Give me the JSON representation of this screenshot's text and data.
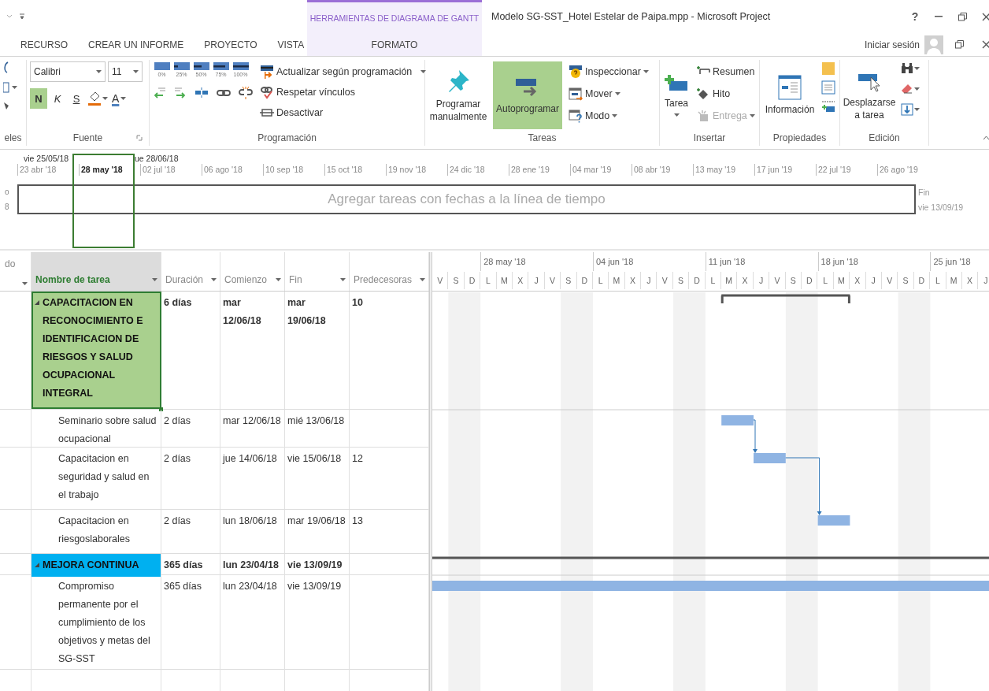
{
  "title_bar": {
    "contextual_group": "HERRAMIENTAS DE DIAGRAMA DE GANTT",
    "title": "Modelo SG-SST_Hotel Estelar de Paipa.mpp - Microsoft Project",
    "help": "?"
  },
  "tabs": [
    {
      "label": "RECURSO",
      "kind": "normal"
    },
    {
      "label": "CREAR UN INFORME",
      "kind": "normal"
    },
    {
      "label": "PROYECTO",
      "kind": "normal"
    },
    {
      "label": "VISTA",
      "kind": "normal"
    },
    {
      "label": "FORMATO",
      "kind": "contextual"
    }
  ],
  "account": {
    "label": "Iniciar sesión"
  },
  "ribbon": {
    "clipboard_group": {
      "label": "eles"
    },
    "font_group": {
      "label": "Fuente",
      "font": "Calibri",
      "size": "11",
      "font_color_letter": "A",
      "styles": [
        {
          "label": "N",
          "kind": "bold",
          "on": true
        },
        {
          "label": "K",
          "kind": "italic",
          "on": false
        },
        {
          "label": "S",
          "kind": "underline",
          "on": false
        }
      ]
    },
    "schedule_group": {
      "label": "Programación",
      "percent_buttons": [
        "0%",
        "25%",
        "50%",
        "75%",
        "100%"
      ],
      "commands": [
        {
          "label": "Actualizar según programación",
          "kind": "update",
          "menu": true
        },
        {
          "label": "Respetar vínculos",
          "kind": "respect",
          "menu": false
        },
        {
          "label": "Desactivar",
          "kind": "deactivate",
          "menu": false
        }
      ]
    },
    "tasks_group": {
      "label": "Tareas",
      "mode_buttons": [
        {
          "label": "Programar manualmente",
          "kind": "manual",
          "selected": false
        },
        {
          "label": "Autoprogramar",
          "kind": "auto",
          "selected": true
        }
      ],
      "commands": [
        {
          "label": "Inspeccionar",
          "kind": "inspect",
          "menu": true
        },
        {
          "label": "Mover",
          "kind": "move",
          "menu": true
        },
        {
          "label": "Modo",
          "kind": "mode",
          "menu": true
        }
      ]
    },
    "insert_group": {
      "label": "Insertar",
      "task_button": "Tarea",
      "commands": [
        {
          "label": "Resumen",
          "kind": "summary",
          "disabled": false,
          "menu": false
        },
        {
          "label": "Hito",
          "kind": "milestone",
          "disabled": false,
          "menu": false
        },
        {
          "label": "Entrega",
          "kind": "deliverable",
          "disabled": true,
          "menu": true
        }
      ]
    },
    "properties_group": {
      "label": "Propiedades",
      "info_button": "Información"
    },
    "editing_group": {
      "label": "Edición",
      "scroll_button": "Desplazarse a tarea"
    }
  },
  "timeline": {
    "range_start": "vie 25/05/18",
    "range_end": "ue 28/06/18",
    "start_fragments": [
      "o",
      "8"
    ],
    "ticks": [
      {
        "label": "23 abr '18",
        "highlighted": false
      },
      {
        "label": "28 may '18",
        "highlighted": true
      },
      {
        "label": "02 jul '18",
        "highlighted": false
      },
      {
        "label": "06 ago '18",
        "highlighted": false
      },
      {
        "label": "10 sep '18",
        "highlighted": false
      },
      {
        "label": "15 oct '18",
        "highlighted": false
      },
      {
        "label": "19 nov '18",
        "highlighted": false
      },
      {
        "label": "24 dic '18",
        "highlighted": false
      },
      {
        "label": "28 ene '19",
        "highlighted": false
      },
      {
        "label": "04 mar '19",
        "highlighted": false
      },
      {
        "label": "08 abr '19",
        "highlighted": false
      },
      {
        "label": "13 may '19",
        "highlighted": false
      },
      {
        "label": "17 jun '19",
        "highlighted": false
      },
      {
        "label": "22 jul '19",
        "highlighted": false
      },
      {
        "label": "26 ago '19",
        "highlighted": false
      }
    ],
    "placeholder": "Agregar tareas con fechas a la línea de tiempo",
    "finish_label": "Fin",
    "finish_date": "vie 13/09/19"
  },
  "table": {
    "columns": [
      {
        "label": "do",
        "kind": "cut",
        "selected": false
      },
      {
        "label": "Nombre de tarea",
        "kind": "normal",
        "selected": true
      },
      {
        "label": "Duración",
        "kind": "normal",
        "selected": false
      },
      {
        "label": "Comienzo",
        "kind": "normal",
        "selected": false
      },
      {
        "label": "Fin",
        "kind": "normal",
        "selected": false
      },
      {
        "label": "Predecesoras",
        "kind": "normal",
        "selected": false
      }
    ],
    "rows": [
      {
        "name": "CAPACITACION EN RECONOCIMIENTO E IDENTIFICACION DE RIESGOS Y SALUD OCUPACIONAL INTEGRAL",
        "kind": "summary",
        "expanded": true,
        "selected": true,
        "color": "#a9d08e",
        "duration": "6 días",
        "start": "mar 12/06/18",
        "finish": "mar 19/06/18",
        "predecessors": "10"
      },
      {
        "name": "Seminario sobre salud ocupacional",
        "kind": "task",
        "selected": false,
        "duration": "2 días",
        "start": "mar 12/06/18",
        "finish": "mié 13/06/18"
      },
      {
        "name": "Capacitacion en seguridad y salud en el trabajo",
        "kind": "task",
        "selected": false,
        "duration": "2 días",
        "start": "jue 14/06/18",
        "finish": "vie 15/06/18",
        "predecessors": "12"
      },
      {
        "name": "Capacitacion en riesgoslaborales",
        "kind": "task",
        "selected": false,
        "duration": "2 días",
        "start": "lun 18/06/18",
        "finish": "mar 19/06/18",
        "predecessors": "13"
      },
      {
        "name": "MEJORA CONTINUA",
        "kind": "summary",
        "expanded": true,
        "selected": false,
        "color": "#00b0f0",
        "duration": "365 días",
        "start": "lun 23/04/18",
        "finish": "vie 13/09/19"
      },
      {
        "name": "Compromiso permanente por el cumplimiento de los objetivos y metas del SG-SST",
        "kind": "task",
        "selected": false,
        "duration": "365 días",
        "start": "lun 23/04/18",
        "finish": "vie 13/09/19"
      }
    ]
  },
  "gantt": {
    "weeks": [
      "28 may '18",
      "04 jun '18",
      "11 jun '18",
      "18 jun '18",
      "25 jun '18"
    ],
    "days": [
      "V",
      "S",
      "D",
      "L",
      "M",
      "X",
      "J",
      "V",
      "S",
      "D",
      "L",
      "M",
      "X",
      "J",
      "V",
      "S",
      "D",
      "L",
      "M",
      "X",
      "J",
      "V",
      "S",
      "D",
      "L",
      "M",
      "X",
      "J",
      "V",
      "S",
      "D",
      "L",
      "M",
      "X",
      "J"
    ]
  }
}
